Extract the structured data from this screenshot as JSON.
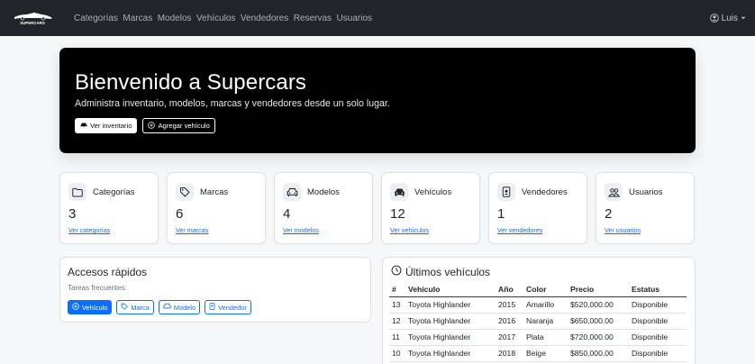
{
  "nav": {
    "brand": "SUPERCARS",
    "links": [
      "Categorías",
      "Marcas",
      "Modelos",
      "Vehículos",
      "Vendedores",
      "Reservas",
      "Usuarios"
    ],
    "user": "Luis"
  },
  "hero": {
    "title": "Bienvenido a Supercars",
    "text": "Administra inventario, modelos, marcas y vendedores desde un solo lugar.",
    "btn_inventory": "Ver inventario",
    "btn_add": "Agregar vehículo"
  },
  "cards": [
    {
      "title": "Categorías",
      "count": "3",
      "link": "Ver categorías",
      "icon": "folder-icon"
    },
    {
      "title": "Marcas",
      "count": "6",
      "link": "Ver marcas",
      "icon": "tag-icon"
    },
    {
      "title": "Modelos",
      "count": "4",
      "link": "Ver modelos",
      "icon": "car-front-icon"
    },
    {
      "title": "Vehículos",
      "count": "12",
      "link": "Ver vehículos",
      "icon": "car-icon"
    },
    {
      "title": "Vendedores",
      "count": "1",
      "link": "Ver vendedores",
      "icon": "badge-icon"
    },
    {
      "title": "Usuarios",
      "count": "2",
      "link": "Ver usuarios",
      "icon": "people-icon"
    }
  ],
  "quick": {
    "title": "Accesos rápidos",
    "subtitle": "Tareas frecuentes:",
    "buttons": [
      "Vehículo",
      "Marca",
      "Modelo",
      "Vendedor"
    ]
  },
  "latest": {
    "title": "Últimos vehículos",
    "columns": [
      "#",
      "Vehículo",
      "Año",
      "Color",
      "Precio",
      "Estatus"
    ],
    "rows": [
      [
        "13",
        "Toyota Highlander",
        "2015",
        "Amarillo",
        "$520,000.00",
        "Disponible"
      ],
      [
        "12",
        "Toyota Highlander",
        "2016",
        "Naranja",
        "$650,000.00",
        "Disponible"
      ],
      [
        "11",
        "Toyota Highlander",
        "2017",
        "Plata",
        "$720,000.00",
        "Disponible"
      ],
      [
        "10",
        "Toyota Highlander",
        "2018",
        "Beige",
        "$850,000.00",
        "Disponible"
      ]
    ]
  },
  "colors": {
    "navbar": "#212529",
    "primary": "#0d6efd",
    "hero": "#000000",
    "background": "#f6f7f9"
  }
}
